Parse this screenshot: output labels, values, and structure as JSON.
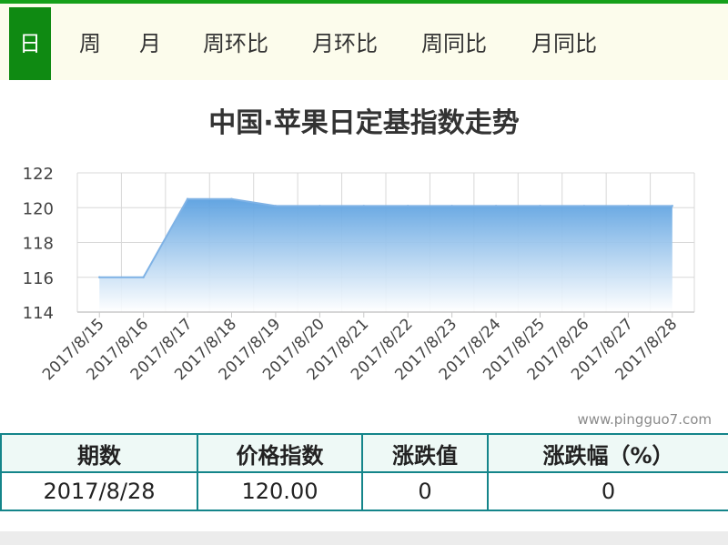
{
  "tabs": [
    {
      "label": "日",
      "active": true
    },
    {
      "label": "周",
      "active": false
    },
    {
      "label": "月",
      "active": false
    },
    {
      "label": "周环比",
      "active": false
    },
    {
      "label": "月环比",
      "active": false
    },
    {
      "label": "周同比",
      "active": false
    },
    {
      "label": "月同比",
      "active": false
    }
  ],
  "watermark": "www.pingguo7.com",
  "colors": {
    "accent": "#0f8a12",
    "line": "#7fb2e5",
    "fill_top": "#5aa0e0",
    "table_border": "#14858a"
  },
  "chart_data": {
    "type": "area",
    "title": "中国·苹果日定基指数走势",
    "xlabel": "",
    "ylabel": "",
    "categories": [
      "2017/8/15",
      "2017/8/16",
      "2017/8/17",
      "2017/8/18",
      "2017/8/19",
      "2017/8/20",
      "2017/8/21",
      "2017/8/22",
      "2017/8/23",
      "2017/8/24",
      "2017/8/25",
      "2017/8/26",
      "2017/8/27",
      "2017/8/28"
    ],
    "values": [
      116.0,
      116.0,
      120.5,
      120.5,
      120.1,
      120.1,
      120.1,
      120.1,
      120.1,
      120.1,
      120.1,
      120.1,
      120.1,
      120.1
    ],
    "ylim": [
      114,
      122
    ],
    "yticks": [
      114,
      116,
      118,
      120,
      122
    ],
    "grid": true
  },
  "table": {
    "headers": [
      "期数",
      "价格指数",
      "涨跌值",
      "涨跌幅（%）"
    ],
    "rows": [
      [
        "2017/8/28",
        "120.00",
        "0",
        "0"
      ]
    ]
  }
}
